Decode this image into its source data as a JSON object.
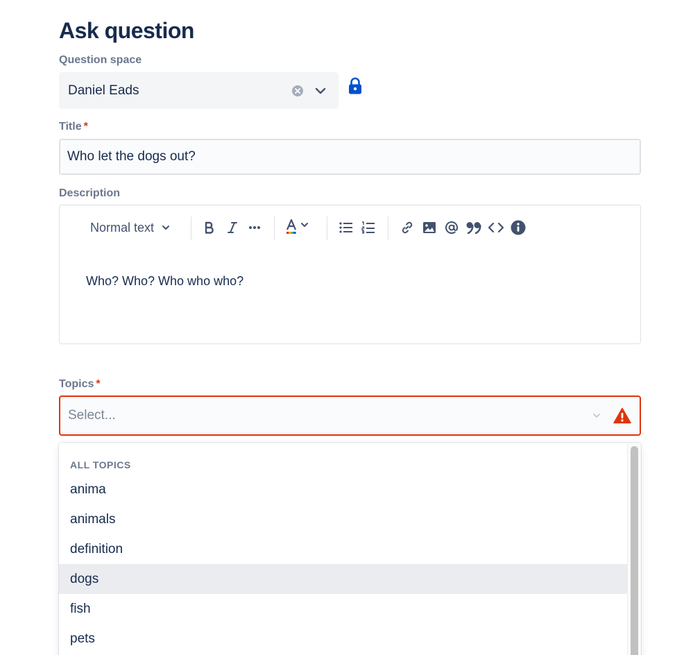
{
  "page": {
    "title": "Ask question"
  },
  "question_space": {
    "label": "Question space",
    "value": "Daniel Eads"
  },
  "title_field": {
    "label": "Title",
    "required_mark": "*",
    "value": "Who let the dogs out?"
  },
  "description": {
    "label": "Description",
    "toolbar": {
      "text_style": "Normal text"
    },
    "content": "Who? Who? Who who who?"
  },
  "topics": {
    "label": "Topics",
    "required_mark": "*",
    "placeholder": "Select...",
    "menu": {
      "group_label": "ALL TOPICS",
      "items": [
        "anima",
        "animals",
        "definition",
        "dogs",
        "fish",
        "pets"
      ],
      "highlighted_index": 3
    }
  },
  "colors": {
    "text": "#172b4d",
    "subtle_text": "#6b778c",
    "error": "#de350b",
    "lock_blue": "#0052cc",
    "input_bg": "#f4f5f7",
    "highlight": "#ebecf0"
  },
  "icons": [
    "clear-icon",
    "chevron-down-icon",
    "lock-icon",
    "bold-icon",
    "italic-icon",
    "more-icon",
    "text-color-icon",
    "bullet-list-icon",
    "numbered-list-icon",
    "link-icon",
    "image-icon",
    "mention-icon",
    "quote-icon",
    "code-icon",
    "info-icon",
    "warning-icon"
  ]
}
